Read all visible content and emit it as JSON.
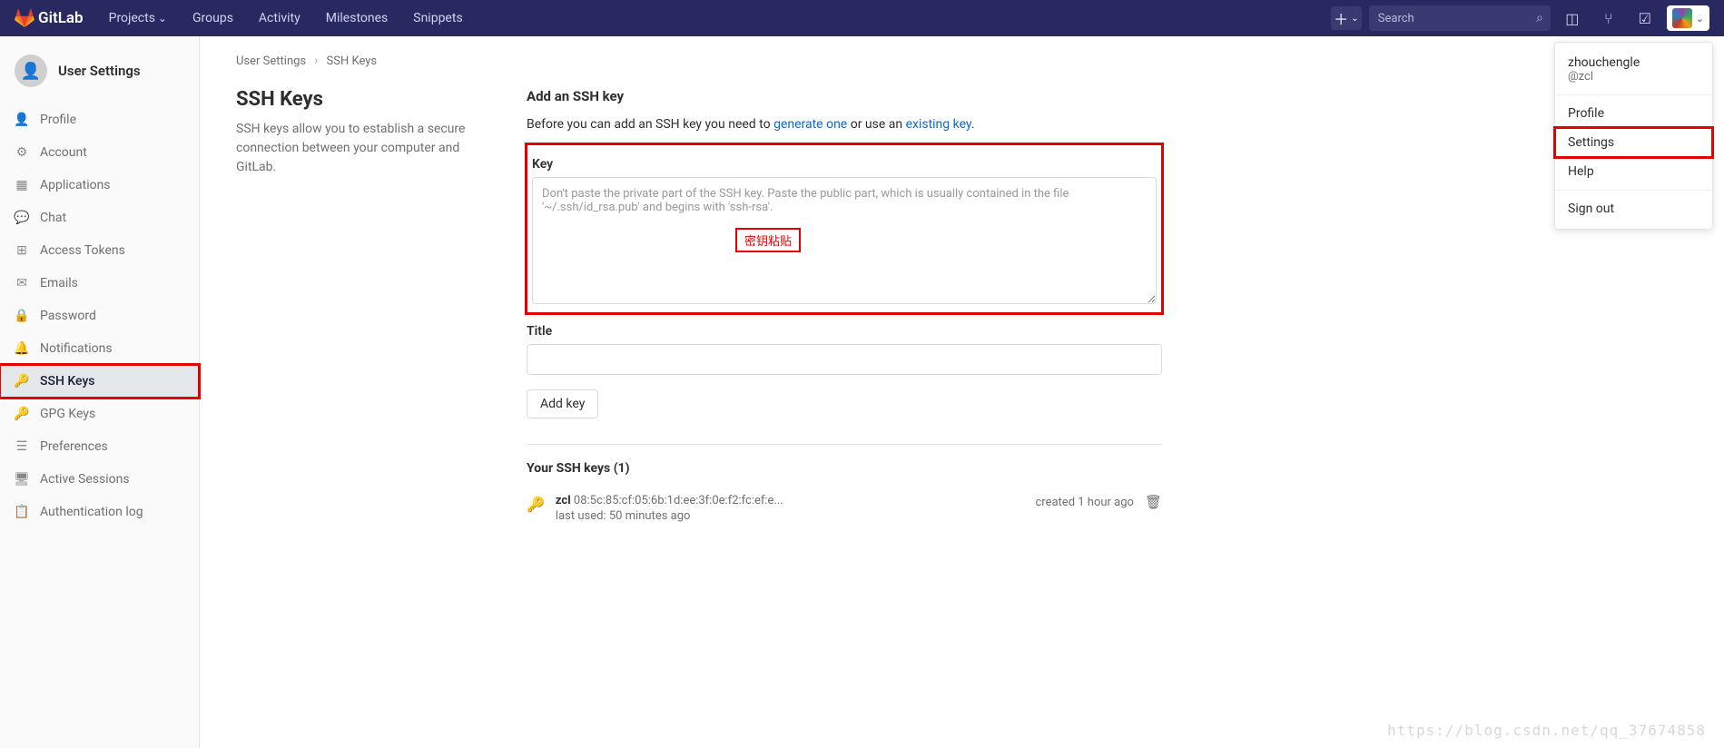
{
  "navbar": {
    "brand": "GitLab",
    "links": [
      "Projects",
      "Groups",
      "Activity",
      "Milestones",
      "Snippets"
    ],
    "search_placeholder": "Search"
  },
  "sidebar": {
    "title": "User Settings",
    "items": [
      {
        "icon": "👤",
        "label": "Profile"
      },
      {
        "icon": "⚙",
        "label": "Account"
      },
      {
        "icon": "▦",
        "label": "Applications"
      },
      {
        "icon": "💬",
        "label": "Chat"
      },
      {
        "icon": "⊞",
        "label": "Access Tokens"
      },
      {
        "icon": "✉",
        "label": "Emails"
      },
      {
        "icon": "🔒",
        "label": "Password"
      },
      {
        "icon": "🔔",
        "label": "Notifications"
      },
      {
        "icon": "🔑",
        "label": "SSH Keys",
        "active": true
      },
      {
        "icon": "🔑",
        "label": "GPG Keys"
      },
      {
        "icon": "☰",
        "label": "Preferences"
      },
      {
        "icon": "🖥",
        "label": "Active Sessions"
      },
      {
        "icon": "📋",
        "label": "Authentication log"
      }
    ]
  },
  "breadcrumb": {
    "root": "User Settings",
    "leaf": "SSH Keys"
  },
  "main": {
    "heading": "SSH Keys",
    "desc": "SSH keys allow you to establish a secure connection between your computer and GitLab.",
    "add_title": "Add an SSH key",
    "hint_pre": "Before you can add an SSH key you need to ",
    "hint_link1": "generate one",
    "hint_mid": " or use an ",
    "hint_link2": "existing key",
    "hint_post": ".",
    "key_label": "Key",
    "key_placeholder": "Don't paste the private part of the SSH key. Paste the public part, which is usually contained in the file '~/.ssh/id_rsa.pub' and begins with 'ssh-rsa'.",
    "title_label": "Title",
    "add_btn": "Add key",
    "list_title": "Your SSH keys (1)",
    "key_entry": {
      "name": "zcl",
      "fingerprint": "08:5c:85:cf:05:6b:1d:ee:3f:0e:f2:fc:ef:e...",
      "last_used": "last used: 50 minutes ago",
      "created": "created 1 hour ago"
    }
  },
  "user_menu": {
    "name": "zhouchengle",
    "handle": "@zcl",
    "items": [
      "Profile",
      "Settings",
      "Help",
      "Sign out"
    ]
  },
  "annotation": "密钥粘贴",
  "watermark": "https://blog.csdn.net/qq_37674858"
}
